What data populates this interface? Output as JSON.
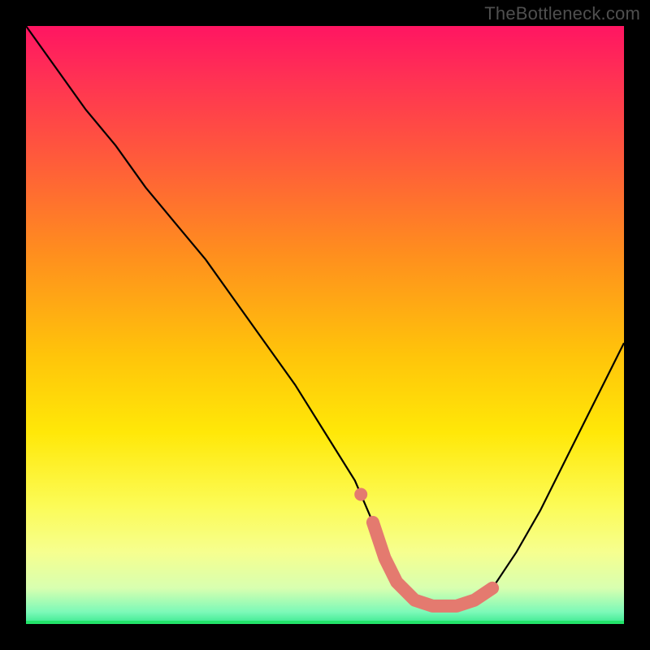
{
  "watermark": "TheBottleneck.com",
  "chart_data": {
    "type": "line",
    "title": "",
    "xlabel": "",
    "ylabel": "",
    "xlim": [
      0,
      100
    ],
    "ylim": [
      0,
      100
    ],
    "grid": false,
    "legend": false,
    "annotations": [],
    "description": "Bottleneck curve on a vertical red-to-green gradient. The black line descends steeply from upper-left, reaches a flat minimum (highlighted with pink segment) near x≈62–75, then rises toward the right edge.",
    "series": [
      {
        "name": "bottleneck_curve",
        "x": [
          0,
          5,
          10,
          15,
          20,
          25,
          30,
          35,
          40,
          45,
          50,
          55,
          58,
          60,
          62,
          65,
          68,
          72,
          75,
          78,
          82,
          86,
          90,
          94,
          98,
          100
        ],
        "values": [
          100,
          93,
          86,
          80,
          73,
          67,
          61,
          54,
          47,
          40,
          32,
          24,
          17,
          11,
          7,
          4,
          3,
          3,
          4,
          6,
          12,
          19,
          27,
          35,
          43,
          47
        ]
      }
    ],
    "highlight": {
      "name": "optimal_region",
      "x_range": [
        58,
        78
      ],
      "color": "#e47a6f",
      "note": "pink rounded stroke marking the flat bottom of the curve plus a small detached dot just before it"
    },
    "background_gradient": {
      "direction": "vertical",
      "stops": [
        {
          "pos": 0.0,
          "color": "#ff1562"
        },
        {
          "pos": 0.22,
          "color": "#ff5a3b"
        },
        {
          "pos": 0.55,
          "color": "#ffc40a"
        },
        {
          "pos": 0.8,
          "color": "#fcfb55"
        },
        {
          "pos": 0.98,
          "color": "#7cf9b8"
        },
        {
          "pos": 1.0,
          "color": "#23e36a"
        }
      ]
    }
  }
}
